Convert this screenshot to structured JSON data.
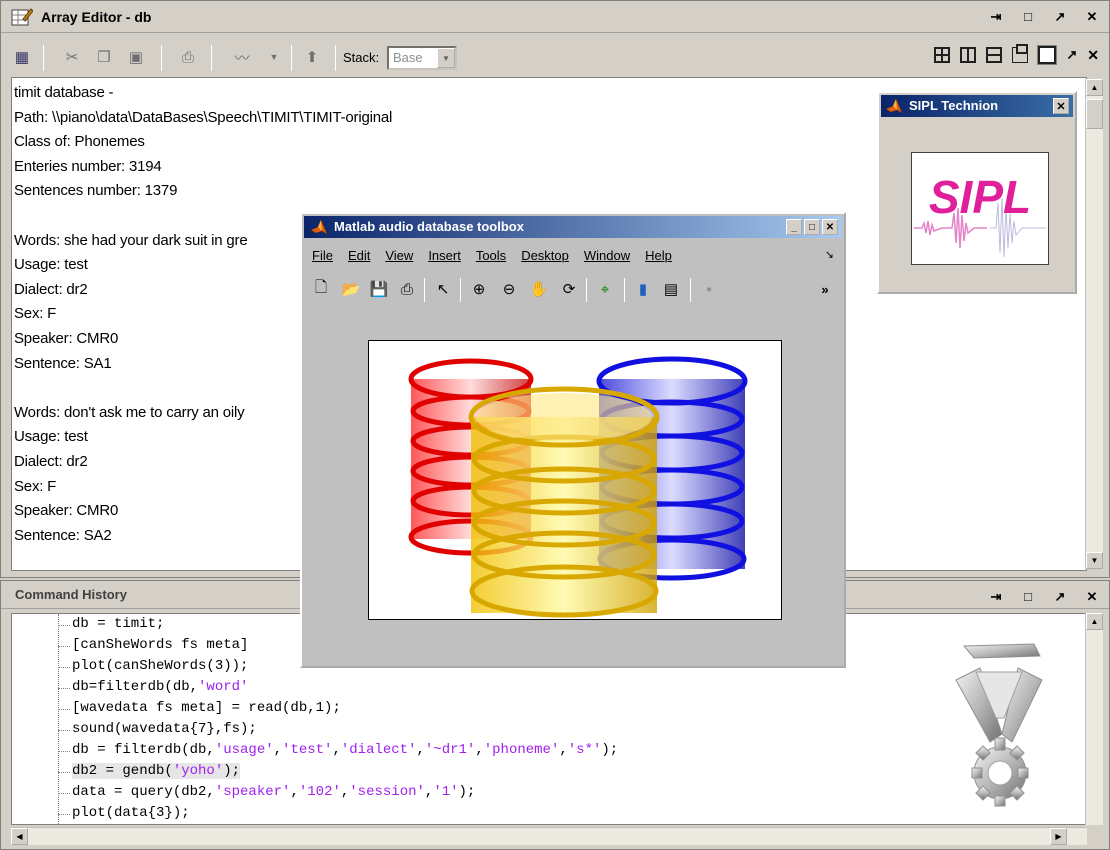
{
  "array_editor": {
    "title": "Array Editor - db",
    "panel_controls": [
      "⇥",
      "□",
      "↗",
      "✕"
    ],
    "toolbar": {
      "stack_label": "Stack:",
      "stack_value": "Base"
    },
    "lines": [
      "timit database -",
      "Path: \\\\piano\\data\\DataBases\\Speech\\TIMIT\\TIMIT-original",
      "Class of: Phonemes",
      "Enteries number: 3194",
      "Sentences number: 1379",
      "",
      "Words: she had your dark suit in gre",
      "Usage: test",
      "Dialect: dr2",
      "Sex: F",
      "Speaker: CMR0",
      "Sentence: SA1",
      "",
      "Words: don't ask me to carry an oily",
      "Usage: test",
      "Dialect: dr2",
      "Sex: F",
      "Speaker: CMR0",
      "Sentence: SA2"
    ]
  },
  "sipl_window": {
    "title": "SIPL Technion",
    "logo_text": "SIPL"
  },
  "figure_window": {
    "title": "Matlab audio database toolbox",
    "menu": [
      "File",
      "Edit",
      "View",
      "Insert",
      "Tools",
      "Desktop",
      "Window",
      "Help"
    ]
  },
  "command_history": {
    "title": "Command History",
    "panel_controls": [
      "⇥",
      "□",
      "↗",
      "✕"
    ],
    "commands": [
      "db = timit;",
      "[canSheWords fs meta]",
      "plot(canSheWords(3));",
      "db=filterdb(db,'word'",
      "[wavedata fs meta] = read(db,1);",
      "sound(wavedata{7},fs);",
      "db = filterdb(db,'usage','test','dialect','~dr1','phoneme','s*');",
      "db2 = gendb('yoho');",
      "data = query(db2,'speaker','102','session','1');",
      "plot(data{3});"
    ],
    "selected_index": 7
  },
  "colors": {
    "title_blue": "#0a246a",
    "string_purple": "#a020f0",
    "panel_gray": "#d4d0c8"
  }
}
